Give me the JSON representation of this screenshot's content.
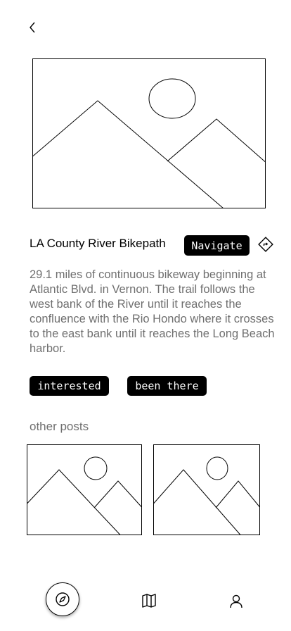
{
  "header": {
    "back_icon": "chevron-left-icon"
  },
  "hero": {
    "image_kind": "image-placeholder"
  },
  "trail": {
    "title": "LA County River Bikepath",
    "navigate_label": "Navigate",
    "directions_icon": "directions-icon",
    "description": "29.1 miles of continuous bikeway beginning at Atlantic Blvd. in Vernon. The trail follows the west bank of the River until it reaches the confluence with the Rio Hondo where it crosses to the east bank until it reaches the Long Beach harbor."
  },
  "actions": {
    "interested_label": "interested",
    "been_there_label": "been there"
  },
  "other_posts": {
    "label": "other posts",
    "count": 2
  },
  "tab_bar": {
    "items": [
      "compass-icon",
      "map-icon",
      "user-icon"
    ],
    "active": "compass-icon"
  },
  "colors": {
    "primary": "#000000",
    "muted_text": "#6f6f6f",
    "background": "#ffffff"
  }
}
